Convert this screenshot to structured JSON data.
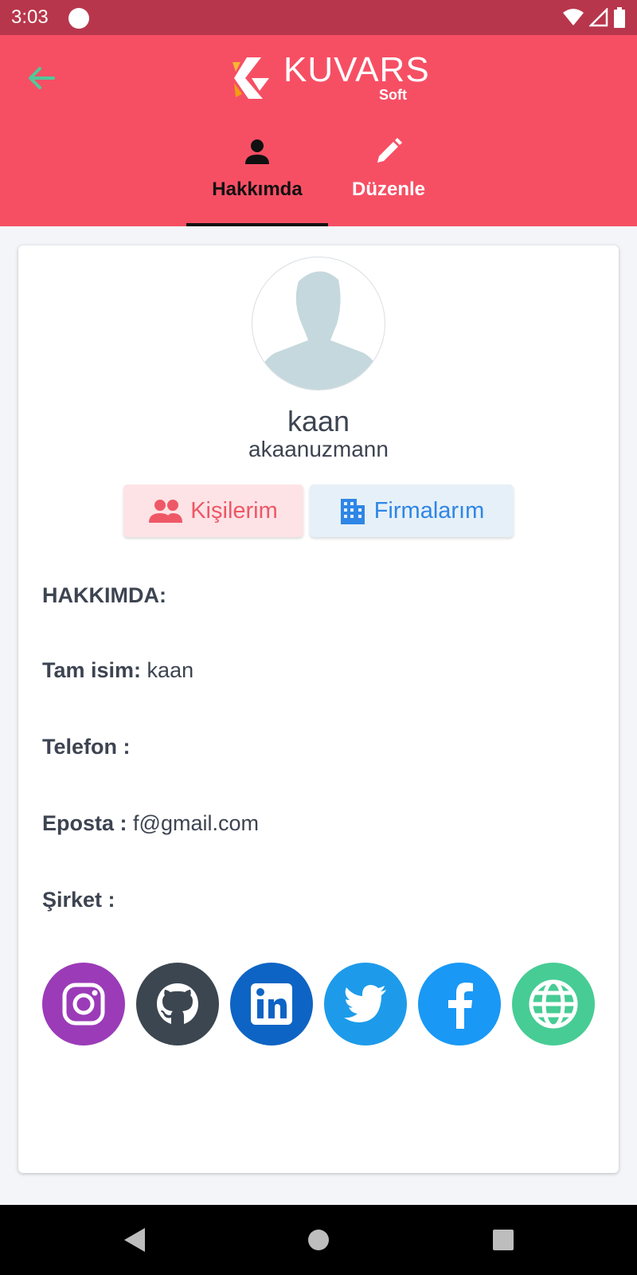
{
  "status_bar": {
    "time": "3:03"
  },
  "header": {
    "logo_text": "KUVARS",
    "logo_sub": "Soft",
    "tabs": [
      {
        "label": "Hakkımda",
        "icon": "person-icon",
        "active": true
      },
      {
        "label": "Düzenle",
        "icon": "pencil-icon",
        "active": false
      }
    ],
    "colors": {
      "background": "#f64f64",
      "status_bar": "#b8364b"
    }
  },
  "profile": {
    "name": "kaan",
    "handle": "akaanuzmann"
  },
  "buttons": {
    "contacts": "Kişilerim",
    "companies": "Firmalarım"
  },
  "about": {
    "heading": "HAKKIMDA:",
    "full_name_label": "Tam isim:",
    "full_name_value": "kaan",
    "phone_label": "Telefon :",
    "phone_value": "",
    "email_label": "Eposta :",
    "email_value": "f@gmail.com",
    "company_label": "Şirket :",
    "company_value": ""
  },
  "social": [
    {
      "icon": "instagram-icon",
      "color": "#9b3bb8"
    },
    {
      "icon": "github-icon",
      "color": "#3c4650"
    },
    {
      "icon": "linkedin-icon",
      "color": "#0e64c4"
    },
    {
      "icon": "twitter-icon",
      "color": "#1d9bea"
    },
    {
      "icon": "facebook-icon",
      "color": "#1998f5"
    },
    {
      "icon": "globe-icon",
      "color": "#47cc95"
    }
  ]
}
